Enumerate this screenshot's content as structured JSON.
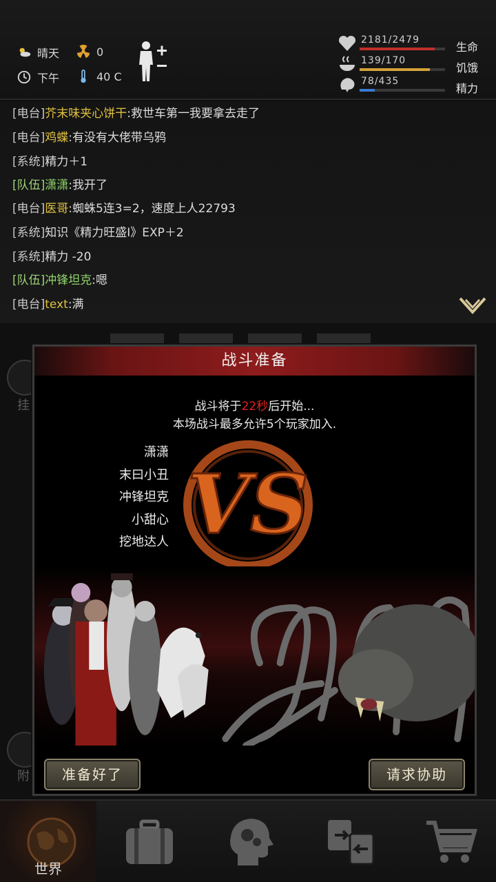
{
  "status": {
    "weather": "晴天",
    "radiation": "0",
    "time_of_day": "下午",
    "temperature": "40 C",
    "health": {
      "value": "2181/2479",
      "label": "生命",
      "fill": 0.88,
      "color": "#c0302a"
    },
    "hunger": {
      "value": "139/170",
      "label": "饥饿",
      "fill": 0.82,
      "color": "#d4a23a"
    },
    "energy": {
      "value": "78/435",
      "label": "精力",
      "fill": 0.18,
      "color": "#3a7ad0"
    }
  },
  "chat": [
    {
      "tag": "[电台]",
      "name": "芥末味夹心饼干",
      "msg": ":救世车第一我要拿去走了",
      "kind": "radio"
    },
    {
      "tag": "[电台]",
      "name": "鸡蝶",
      "msg": ":有没有大佬带乌鸦",
      "kind": "radio"
    },
    {
      "tag": "[系统]",
      "name": "",
      "msg": "精力＋1",
      "kind": "sys"
    },
    {
      "tag": "[队伍]",
      "name": "潇潇",
      "msg": ":我开了",
      "kind": "team"
    },
    {
      "tag": "[电台]",
      "name": "医哥",
      "msg": ":蜘蛛5连3=2，速度上人22793",
      "kind": "radio"
    },
    {
      "tag": "[系统]",
      "name": "",
      "msg": "知识《精力旺盛Ⅰ》EXP＋2",
      "kind": "sys"
    },
    {
      "tag": "[系统]",
      "name": "",
      "msg": "精力 -20",
      "kind": "sys"
    },
    {
      "tag": "[队伍]",
      "name": "冲锋坦克",
      "msg": ":嗯",
      "kind": "team"
    },
    {
      "tag": "[电台]",
      "name": "text",
      "msg": ":满",
      "kind": "radio"
    }
  ],
  "modal": {
    "title": "战斗准备",
    "countdown_prefix": "战斗将于",
    "countdown_secs": "22秒",
    "countdown_suffix": "后开始...",
    "limit_text": "本场战斗最多允许5个玩家加入.",
    "vs_text": "VS",
    "players": [
      "潇潇",
      "末曰小丑",
      "冲锋坦克",
      "小甜心",
      "挖地达人"
    ],
    "ready_button": "准备好了",
    "help_button": "请求协助"
  },
  "background": {
    "left_label_top": "挂",
    "left_label_bottom": "附"
  },
  "nav": {
    "world_label": "世界",
    "items": [
      "world-icon",
      "inventory-icon",
      "skills-icon",
      "exchange-icon",
      "shop-icon"
    ]
  }
}
